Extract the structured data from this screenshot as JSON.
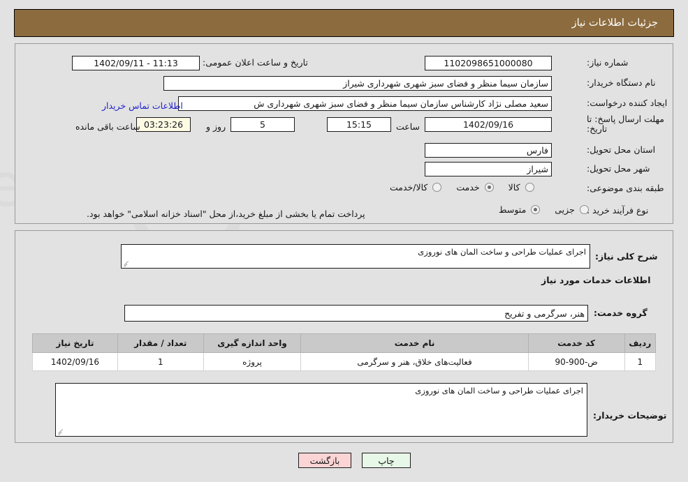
{
  "header": {
    "title": "جزئیات اطلاعات نیاز"
  },
  "top_section": {
    "need_number": {
      "label": "شماره نیاز:",
      "value": "1102098651000080"
    },
    "public_announce": {
      "label": "تاریخ و ساعت اعلان عمومی:",
      "value": "11:13 - 1402/09/11"
    },
    "buyer_org": {
      "label": "نام دستگاه خریدار:",
      "value": "سازمان سیما منظر و فضای سبز شهری شهرداری شیراز"
    },
    "request_creator": {
      "label": "ایجاد کننده درخواست:",
      "value": "سعید مصلی نژاد کارشناس سازمان سیما منظر و فضای سبز شهری شهرداری ش",
      "contact_link": "اطلاعات تماس خریدار"
    },
    "deadline": {
      "label": "مهلت ارسال پاسخ: تا تاریخ:",
      "date": "1402/09/16",
      "hour_label": "ساعت",
      "time": "15:15",
      "days_remaining": "5",
      "days_label": "روز و",
      "countdown": "03:23:26",
      "remaining_label": "ساعت باقی مانده"
    },
    "delivery_province": {
      "label": "استان محل تحویل:",
      "value": "فارس"
    },
    "delivery_city": {
      "label": "شهر محل تحویل:",
      "value": "شیراز"
    },
    "subject_category": {
      "label": "طبقه بندی موضوعی:",
      "options": [
        "کالا",
        "خدمت",
        "کالا/خدمت"
      ],
      "selected": "خدمت"
    },
    "purchase_process": {
      "label": "نوع فرآیند خرید :",
      "options": [
        "جزیی",
        "متوسط"
      ],
      "selected": "متوسط",
      "note": "پرداخت تمام یا بخشی از مبلغ خرید،از محل \"اسناد خزانه اسلامی\" خواهد بود."
    }
  },
  "main_section": {
    "general_description": {
      "label": "شرح کلی نیاز:",
      "value": "اجرای عملیات طراحی و ساخت المان های نوروزی"
    },
    "services_heading": "اطلاعات خدمات مورد نیاز",
    "service_group": {
      "label": "گروه خدمت:",
      "value": "هنر، سرگرمی و تفریح"
    },
    "table": {
      "columns": [
        "ردیف",
        "کد خدمت",
        "نام خدمت",
        "واحد اندازه گیری",
        "تعداد / مقدار",
        "تاریخ نیاز"
      ],
      "rows": [
        {
          "row": "1",
          "service_code": "ض-900-90",
          "service_name": "فعالیت‌های خلاق، هنر و سرگرمی",
          "unit": "پروژه",
          "quantity": "1",
          "need_date": "1402/09/16"
        }
      ]
    },
    "buyer_notes": {
      "label": "توضیحات خریدار:",
      "value": "اجرای عملیات طراحی و ساخت المان های نوروزی"
    }
  },
  "footer": {
    "print_button": "چاپ",
    "back_button": "بازگشت"
  },
  "watermark": {
    "text": "AriaTender.net"
  },
  "colors": {
    "header_bar": "#8c6c3f",
    "page_bg": "#e2e2e2",
    "link": "#2222cc",
    "print_btn": "#e8f8e8",
    "back_btn": "#fbd5d5",
    "countdown_bg": "#fdfbe4",
    "table_header": "#c9c9c9"
  }
}
